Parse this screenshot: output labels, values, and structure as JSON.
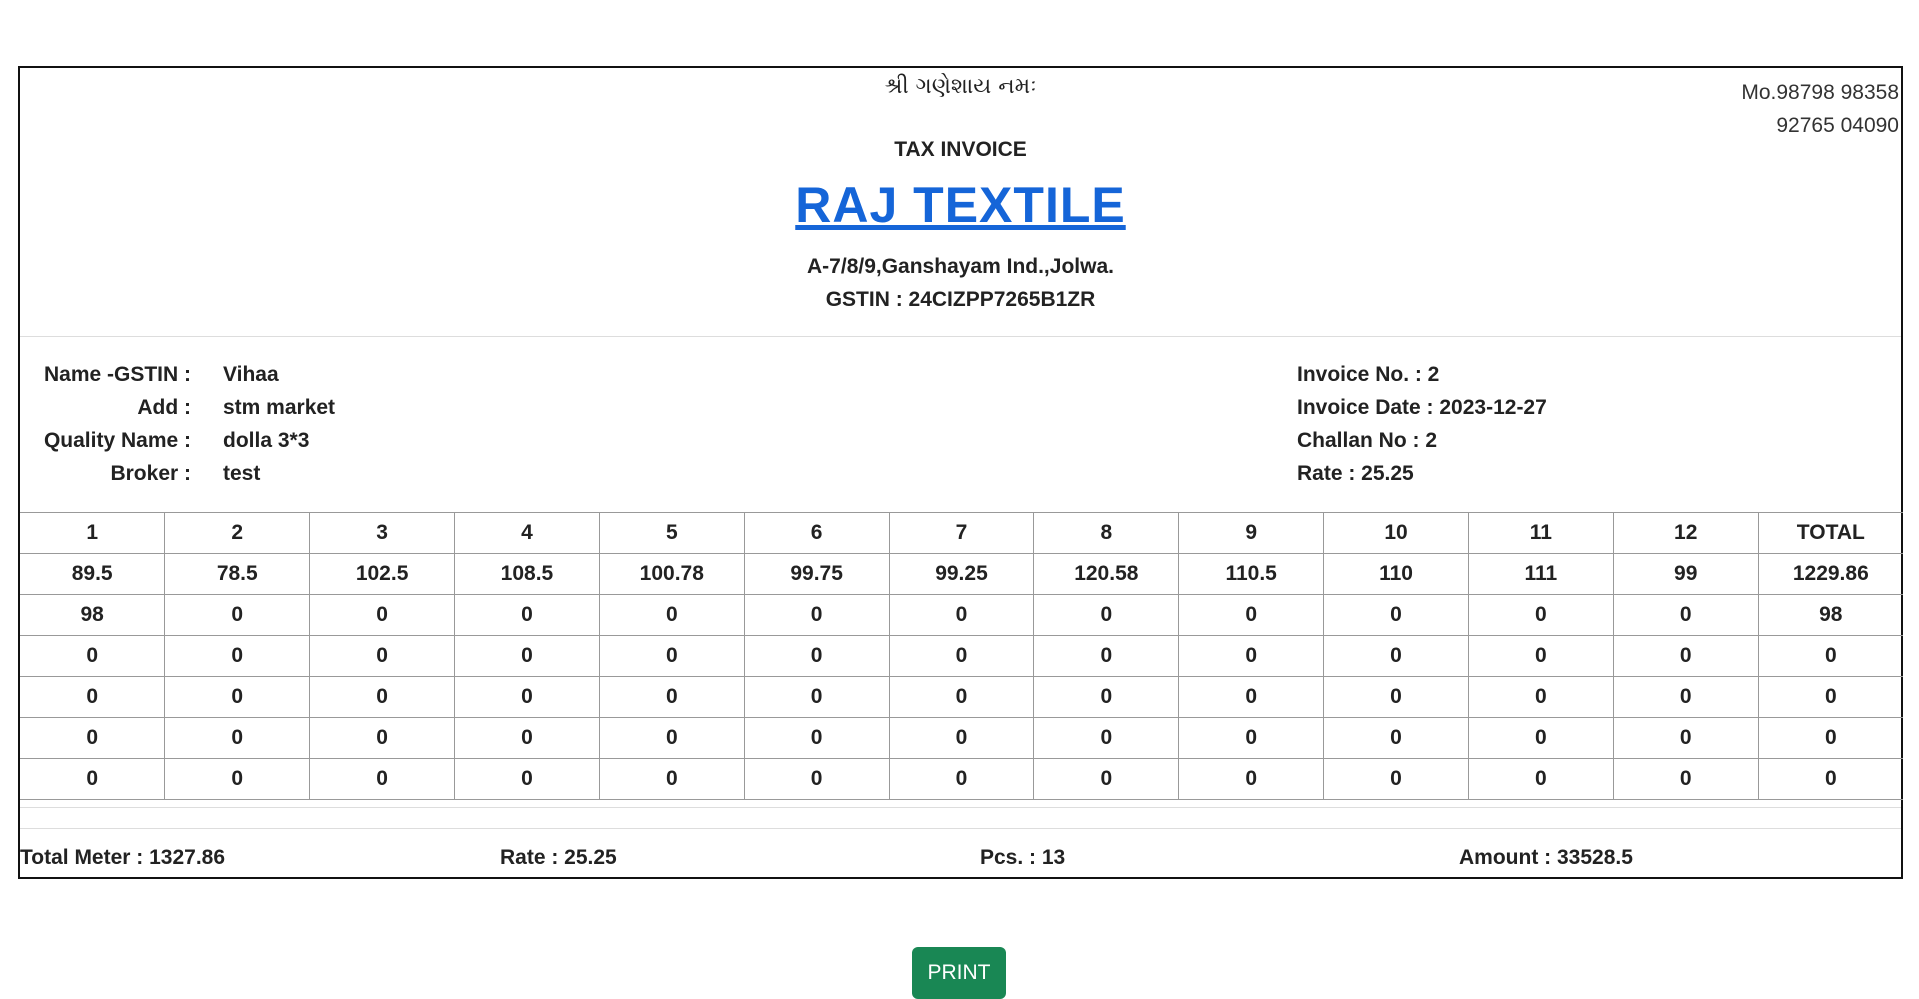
{
  "header": {
    "blessing": "શ્રી ગણેશાય નમઃ",
    "mobile_line1": "Mo.98798 98358",
    "mobile_line2": "92765 04090",
    "doc_type": "TAX INVOICE",
    "company_name": "RAJ TEXTILE",
    "address": "A-7/8/9,Ganshayam Ind.,Jolwa.",
    "gstin": "GSTIN : 24CIZPP7265B1ZR"
  },
  "party": {
    "name_label": "Name -GSTIN :",
    "name_value": "Vihaa",
    "add_label": "Add :",
    "add_value": "stm market",
    "quality_label": "Quality Name :",
    "quality_value": "dolla 3*3",
    "broker_label": "Broker :",
    "broker_value": "test"
  },
  "invoice_meta": {
    "invoice_no": "Invoice No. : 2",
    "invoice_date": "Invoice Date : 2023-12-27",
    "challan_no": "Challan No : 2",
    "rate": "Rate : 25.25"
  },
  "table": {
    "headers": [
      "1",
      "2",
      "3",
      "4",
      "5",
      "6",
      "7",
      "8",
      "9",
      "10",
      "11",
      "12",
      "TOTAL"
    ],
    "rows": [
      [
        "89.5",
        "78.5",
        "102.5",
        "108.5",
        "100.78",
        "99.75",
        "99.25",
        "120.58",
        "110.5",
        "110",
        "111",
        "99",
        "1229.86"
      ],
      [
        "98",
        "0",
        "0",
        "0",
        "0",
        "0",
        "0",
        "0",
        "0",
        "0",
        "0",
        "0",
        "98"
      ],
      [
        "0",
        "0",
        "0",
        "0",
        "0",
        "0",
        "0",
        "0",
        "0",
        "0",
        "0",
        "0",
        "0"
      ],
      [
        "0",
        "0",
        "0",
        "0",
        "0",
        "0",
        "0",
        "0",
        "0",
        "0",
        "0",
        "0",
        "0"
      ],
      [
        "0",
        "0",
        "0",
        "0",
        "0",
        "0",
        "0",
        "0",
        "0",
        "0",
        "0",
        "0",
        "0"
      ],
      [
        "0",
        "0",
        "0",
        "0",
        "0",
        "0",
        "0",
        "0",
        "0",
        "0",
        "0",
        "0",
        "0"
      ]
    ]
  },
  "totals": {
    "total_meter": "Total Meter : 1327.86",
    "rate": "Rate : 25.25",
    "pcs": "Pcs. : 13",
    "amount": "Amount : 33528.5"
  },
  "actions": {
    "print_label": "PRINT"
  },
  "colors": {
    "company": "#1565d8",
    "print_button": "#198754"
  }
}
